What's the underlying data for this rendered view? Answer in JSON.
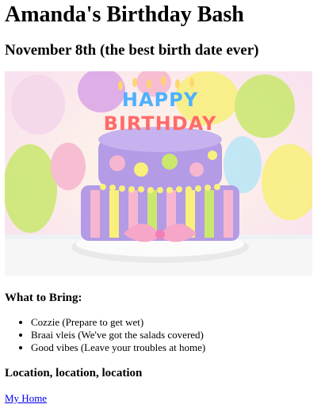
{
  "page": {
    "title": "Amanda's Birthday Bash",
    "subtitle": "November 8th (the best birth date ever)"
  },
  "hero_image": {
    "icon": "birthday-cake-image",
    "candle_text": "HAPPY BIRTHDAY",
    "colors": {
      "background_balloons": [
        "#f5d7ea",
        "#b9e6f6",
        "#f8f07a",
        "#c9e86d",
        "#d9a4e7",
        "#f7b6cf"
      ],
      "cake_purple": "#b39be6",
      "cake_pink": "#f6a6c8",
      "tablecloth": "#f6f6f6"
    }
  },
  "bring": {
    "heading": "What to Bring:",
    "items": [
      {
        "label": "Cozzie (Prepare to get wet)"
      },
      {
        "label": "Braai vleis (We've got the salads covered)"
      },
      {
        "label": "Good vibes (Leave your troubles at home)"
      }
    ]
  },
  "location": {
    "heading": "Location, location, location",
    "link_label": "My Home"
  }
}
